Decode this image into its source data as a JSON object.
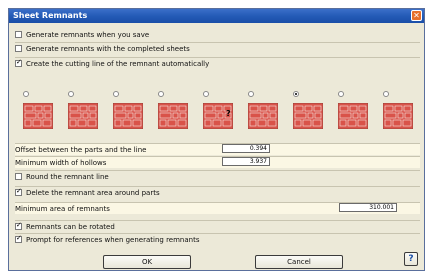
{
  "window": {
    "title": "Sheet Remnants",
    "close_glyph": "✕"
  },
  "options": {
    "generate_when_save": {
      "label": "Generate remnants when you save",
      "checked": false
    },
    "generate_with_sheets": {
      "label": "Generate remnants with the completed sheets",
      "checked": false
    },
    "create_cutting_line": {
      "label": "Create the cutting line of the remnant automatically",
      "checked": true
    }
  },
  "patterns": {
    "selected_index": 6,
    "items": [
      {
        "icon": "remnant-pattern-1-icon"
      },
      {
        "icon": "remnant-pattern-2-icon"
      },
      {
        "icon": "remnant-pattern-3-icon"
      },
      {
        "icon": "remnant-pattern-4-icon"
      },
      {
        "icon": "remnant-pattern-5-icon",
        "glyph": "?"
      },
      {
        "icon": "remnant-pattern-6-icon"
      },
      {
        "icon": "remnant-pattern-7-icon"
      },
      {
        "icon": "remnant-pattern-8-icon"
      },
      {
        "icon": "remnant-pattern-9-icon"
      }
    ]
  },
  "fields": {
    "offset": {
      "label": "Offset between the parts and the line",
      "value": "0.394"
    },
    "min_width": {
      "label": "Minimum width of hollows",
      "value": "3.937"
    },
    "min_area": {
      "label": "Minimum area of remnants",
      "value": "310.001"
    }
  },
  "toggles": {
    "round_line": {
      "label": "Round the remnant line",
      "checked": false
    },
    "delete_area": {
      "label": "Delete the remnant area around parts",
      "checked": true
    },
    "can_rotate": {
      "label": "Remnants can be rotated",
      "checked": true
    },
    "prompt_refs": {
      "label": "Prompt for references when generating remnants",
      "checked": true
    }
  },
  "buttons": {
    "ok": "OK",
    "cancel": "Cancel",
    "help": "?"
  },
  "colors": {
    "title_bar": "#245bb6",
    "close": "#e8702a",
    "thumb_fill": "#d9534a",
    "dialog_bg": "#ece9d8"
  }
}
